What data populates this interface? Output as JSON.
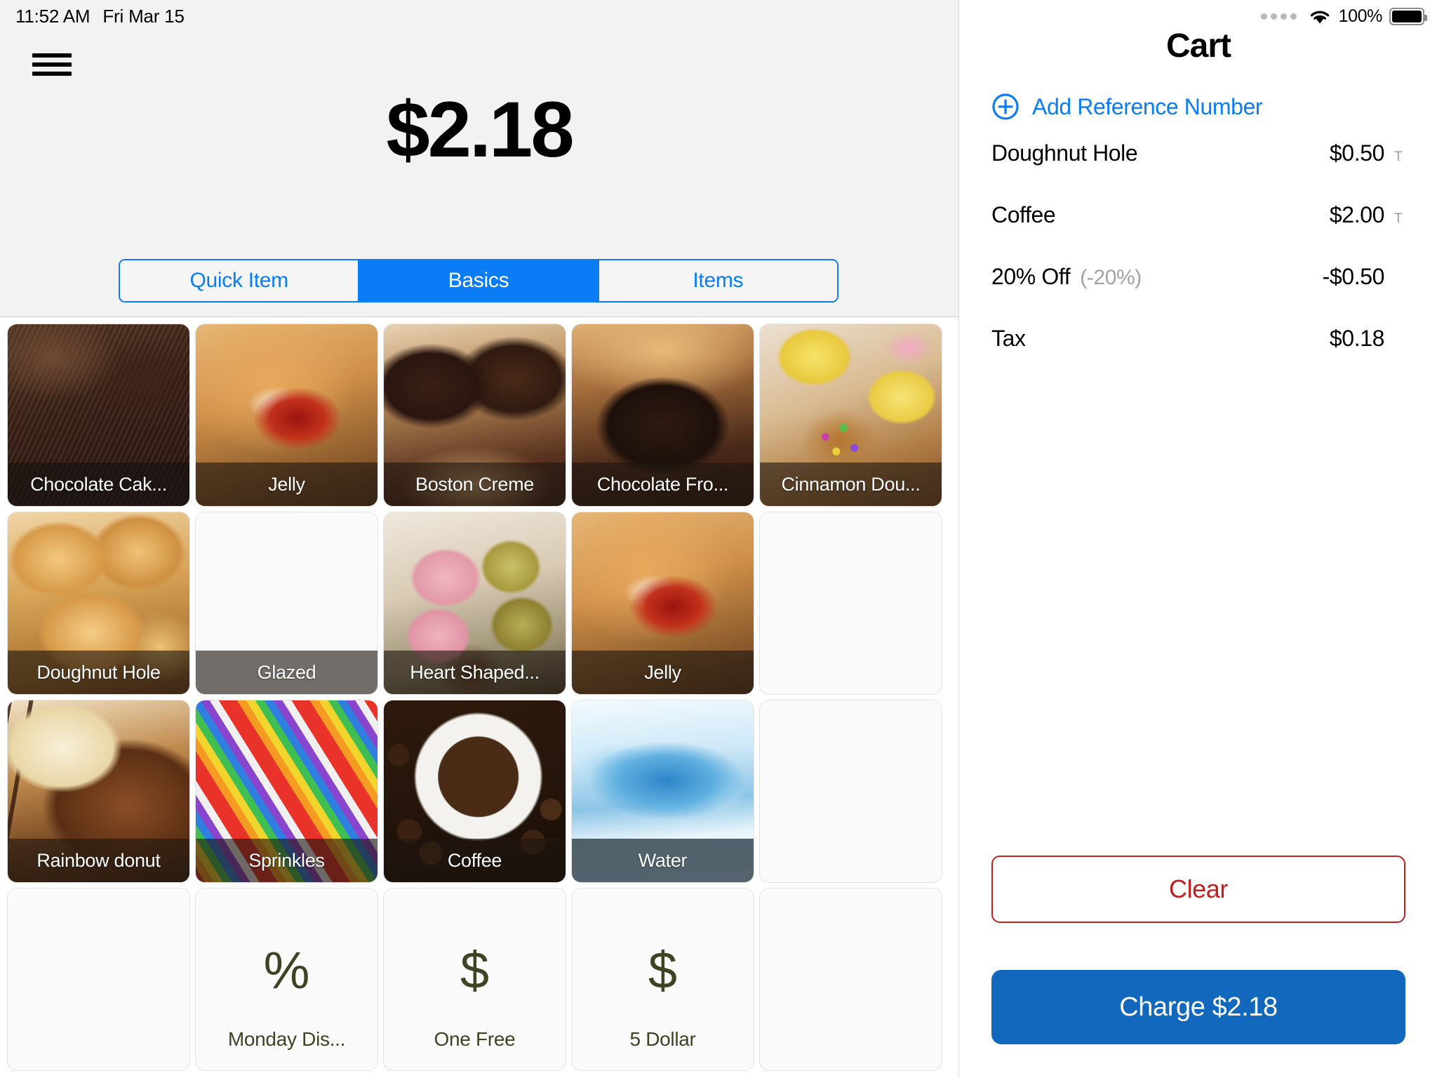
{
  "status_bar": {
    "time": "11:52 AM",
    "date": "Fri Mar 15",
    "battery_percent": "100%",
    "signal_dots": 4
  },
  "pos": {
    "menu_icon": "hamburger-icon",
    "amount_display": "$2.18",
    "tabs": [
      {
        "label": "Quick Item",
        "active": false
      },
      {
        "label": "Basics",
        "active": true
      },
      {
        "label": "Items",
        "active": false
      }
    ],
    "grid": {
      "rows": [
        [
          {
            "label": "Chocolate Cak...",
            "kind": "photo",
            "photo": "chocolate-cake"
          },
          {
            "label": "Jelly",
            "kind": "photo",
            "photo": "jelly-donut"
          },
          {
            "label": "Boston Creme",
            "kind": "photo",
            "photo": "boston-creme"
          },
          {
            "label": "Chocolate Fro...",
            "kind": "photo",
            "photo": "chocolate-frosted"
          },
          {
            "label": "Cinnamon Dou...",
            "kind": "photo",
            "photo": "cinnamon-donut"
          }
        ],
        [
          {
            "label": "Doughnut Hole",
            "kind": "photo",
            "photo": "doughnut-hole"
          },
          {
            "label": "Glazed",
            "kind": "photo",
            "photo": "glazed-donut"
          },
          {
            "label": "Heart Shaped...",
            "kind": "photo",
            "photo": "heart-shaped"
          },
          {
            "label": "Jelly",
            "kind": "photo",
            "photo": "jelly-donut"
          },
          {
            "label": "",
            "kind": "empty",
            "photo": ""
          }
        ],
        [
          {
            "label": "Rainbow donut",
            "kind": "photo",
            "photo": "rainbow-donut"
          },
          {
            "label": "Sprinkles",
            "kind": "photo",
            "photo": "sprinkles"
          },
          {
            "label": "Coffee",
            "kind": "photo",
            "photo": "coffee"
          },
          {
            "label": "Water",
            "kind": "photo",
            "photo": "water"
          },
          {
            "label": "",
            "kind": "empty",
            "photo": ""
          }
        ],
        [
          {
            "label": "",
            "kind": "empty",
            "symbol": ""
          },
          {
            "label": "Monday Dis...",
            "kind": "discount",
            "symbol": "%"
          },
          {
            "label": "One Free",
            "kind": "discount",
            "symbol": "$"
          },
          {
            "label": "5 Dollar",
            "kind": "discount",
            "symbol": "$"
          },
          {
            "label": "",
            "kind": "empty",
            "symbol": ""
          }
        ]
      ]
    }
  },
  "cart": {
    "title": "Cart",
    "add_reference_label": "Add Reference Number",
    "add_reference_icon": "plus-circle-icon",
    "line_items": [
      {
        "name": "Doughnut Hole",
        "sub": "",
        "amount": "$0.50",
        "tax_mark": "T"
      },
      {
        "name": "Coffee",
        "sub": "",
        "amount": "$2.00",
        "tax_mark": "T"
      },
      {
        "name": "20% Off",
        "sub": "(-20%)",
        "amount": "-$0.50",
        "tax_mark": ""
      },
      {
        "name": "Tax",
        "sub": "",
        "amount": "$0.18",
        "tax_mark": ""
      }
    ],
    "clear_label": "Clear",
    "charge_label": "Charge $2.18"
  },
  "colors": {
    "accent_blue": "#0a7cf5",
    "charge_blue": "#1168bd",
    "clear_red": "#c0201f",
    "discount_olive": "#3f4323",
    "header_gray": "#f2f2f2"
  }
}
